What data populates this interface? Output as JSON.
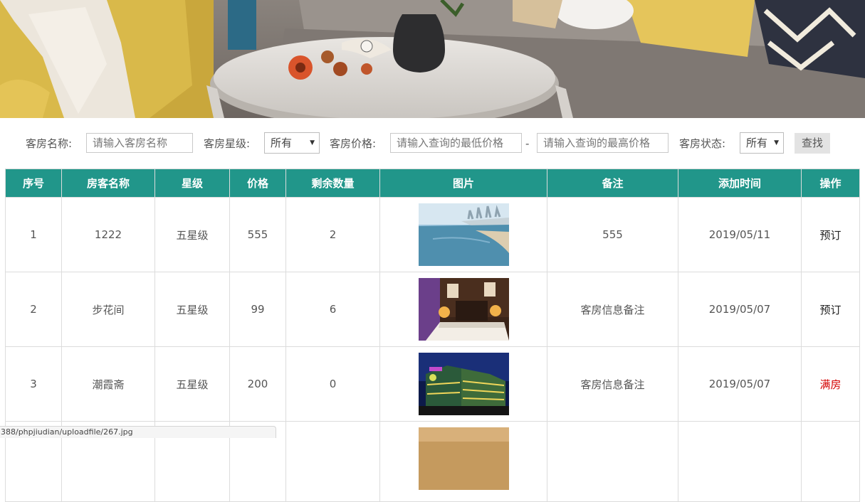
{
  "search": {
    "room_name_label": "客房名称:",
    "room_name_placeholder": "请输入客房名称",
    "star_label": "客房星级:",
    "star_value": "所有",
    "price_label": "客房价格:",
    "min_price_placeholder": "请输入查询的最低价格",
    "dash": "-",
    "max_price_placeholder": "请输入查询的最高价格",
    "status_label": "客房状态:",
    "status_value": "所有",
    "search_button": "查找"
  },
  "table": {
    "headers": [
      "序号",
      "房客名称",
      "星级",
      "价格",
      "剩余数量",
      "图片",
      "备注",
      "添加时间",
      "操作"
    ],
    "rows": [
      {
        "no": "1",
        "name": "1222",
        "star": "五星级",
        "price": "555",
        "remaining": "2",
        "image": "sea-bay-photo",
        "note": "555",
        "added": "2019/05/11",
        "action": "预订"
      },
      {
        "no": "2",
        "name": "步花间",
        "star": "五星级",
        "price": "99",
        "remaining": "6",
        "image": "hotel-room-photo",
        "note": "客房信息备注",
        "added": "2019/05/07",
        "action": "预订"
      },
      {
        "no": "3",
        "name": "潮霞斋",
        "star": "五星级",
        "price": "200",
        "remaining": "0",
        "image": "hotel-night-photo",
        "note": "客房信息备注",
        "added": "2019/05/07",
        "action": "满房"
      }
    ]
  },
  "colors": {
    "header_bg": "#21968a",
    "full_text": "#d40000"
  },
  "statusbar": {
    "url": "388/phpjiudian/uploadfile/267.jpg"
  }
}
